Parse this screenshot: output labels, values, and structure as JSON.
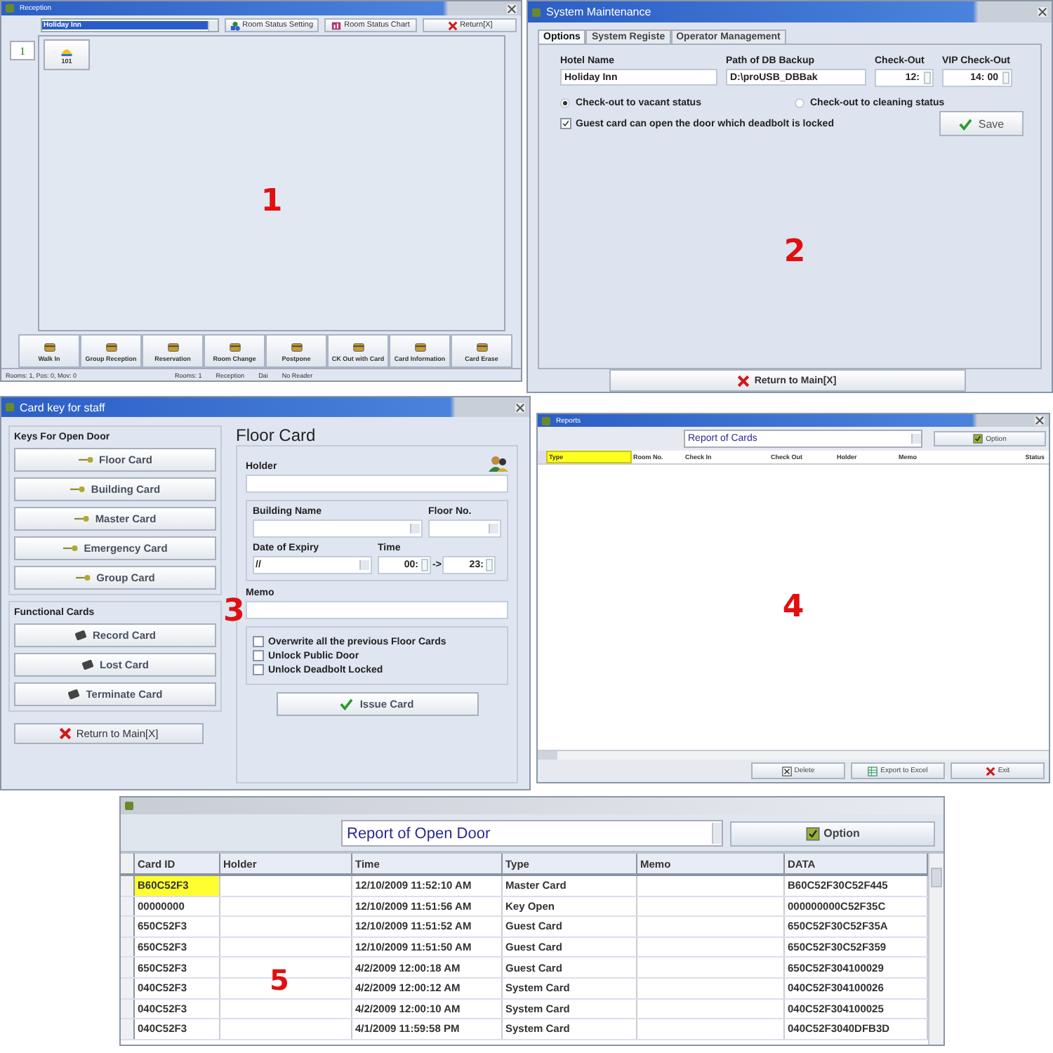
{
  "reception": {
    "title": "Reception",
    "hotel_select": "Holiday Inn",
    "toolbar_buttons": [
      {
        "label": "Room Status Setting",
        "kind": "setting"
      },
      {
        "label": "Room Status Chart",
        "kind": "chart"
      },
      {
        "label": "Return[X]",
        "kind": "return"
      }
    ],
    "floors": [
      "1"
    ],
    "rooms": [
      "101"
    ],
    "panel_number": "1",
    "actions": [
      "Walk In",
      "Group Reception",
      "Reservation",
      "Room Change",
      "Postpone",
      "CK Out with Card",
      "Card Information",
      "Card Erase"
    ],
    "status_bar": [
      "Rooms: 1, Pos: 0, Mov: 0",
      "Rooms: 1",
      "Reception",
      "Dai",
      "No Reader"
    ]
  },
  "maintenance": {
    "title": "System Maintenance",
    "tabs": [
      {
        "label": "Options",
        "selected": true
      },
      {
        "label": "System Registe",
        "selected": false
      },
      {
        "label": "Operator Management",
        "selected": false
      }
    ],
    "fields": [
      {
        "label": "Hotel Name",
        "value": "Holiday Inn",
        "kind": "text"
      },
      {
        "label": "Path of DB Backup",
        "value": "D:\\proUSB_DBBak",
        "kind": "text"
      },
      {
        "label": "Check-Out",
        "value": "12:",
        "kind": "time"
      },
      {
        "label": "VIP Check-Out",
        "value": "14: 00",
        "kind": "time"
      }
    ],
    "radios": [
      {
        "label": "Check-out to vacant status",
        "selected": true
      },
      {
        "label": "Check-out to cleaning status",
        "selected": false
      }
    ],
    "checkbox": {
      "label": "Guest card can open the door which deadbolt is locked",
      "checked": true
    },
    "save_button": "Save",
    "return_button": "Return to Main[X]",
    "panel_number": "2"
  },
  "card_key": {
    "title": "Card key for staff",
    "keys_group": {
      "title": "Keys For Open Door",
      "buttons": [
        "Floor Card",
        "Building Card",
        "Master Card",
        "Emergency Card",
        "Group Card"
      ]
    },
    "functional_group": {
      "title": "Functional Cards",
      "buttons": [
        "Record Card",
        "Lost Card",
        "Terminate Card"
      ]
    },
    "return_button": "Return to Main[X]",
    "form": {
      "title": "Floor Card",
      "holder_label": "Holder",
      "building_label": "Building Name",
      "floor_label": "Floor No.",
      "expiry_label": "Date of Expiry",
      "expiry_value": "//",
      "time_label": "Time",
      "time_from": "00:",
      "time_arrow": "->",
      "time_to": "23:",
      "memo_label": "Memo",
      "options": [
        {
          "label": "Overwrite all the previous Floor Cards",
          "checked": false
        },
        {
          "label": "Unlock Public Door",
          "checked": false
        },
        {
          "label": "Unlock Deadbolt Locked",
          "checked": false
        }
      ],
      "issue_button": "Issue Card"
    },
    "panel_number": "3"
  },
  "reports": {
    "title": "Reports",
    "report_select": "Report of Cards",
    "option_button": "Option",
    "columns": [
      {
        "label": "Type",
        "selected": true
      },
      {
        "label": "Room No.",
        "selected": false
      },
      {
        "label": "Check In",
        "selected": false
      },
      {
        "label": "Check Out",
        "selected": false
      },
      {
        "label": "Holder",
        "selected": false
      },
      {
        "label": "Memo",
        "selected": false
      },
      {
        "label": "Status",
        "selected": false
      }
    ],
    "buttons": [
      {
        "label": "Delete",
        "kind": "delete"
      },
      {
        "label": "Export to Excel",
        "kind": "export"
      },
      {
        "label": "Exit",
        "kind": "exit"
      }
    ],
    "panel_number": "4"
  },
  "open_door_report": {
    "report_select": "Report of Open Door",
    "option_button": "Option",
    "columns": [
      "Card ID",
      "Holder",
      "Time",
      "Type",
      "Memo",
      "DATA"
    ],
    "rows": [
      {
        "cells": [
          "B60C52F3",
          "",
          "12/10/2009 11:52:10 AM",
          "Master Card",
          "",
          "B60C52F30C52F445"
        ],
        "selected": true
      },
      {
        "cells": [
          "00000000",
          "",
          "12/10/2009 11:51:56 AM",
          "Key Open",
          "",
          "000000000C52F35C"
        ],
        "selected": false
      },
      {
        "cells": [
          "650C52F3",
          "",
          "12/10/2009 11:51:52 AM",
          "Guest Card",
          "",
          "650C52F30C52F35A"
        ],
        "selected": false
      },
      {
        "cells": [
          "650C52F3",
          "",
          "12/10/2009 11:51:50 AM",
          "Guest Card",
          "",
          "650C52F30C52F359"
        ],
        "selected": false
      },
      {
        "cells": [
          "650C52F3",
          "",
          "4/2/2009 12:00:18 AM",
          "Guest Card",
          "",
          "650C52F304100029"
        ],
        "selected": false
      },
      {
        "cells": [
          "040C52F3",
          "",
          "4/2/2009 12:00:12 AM",
          "System Card",
          "",
          "040C52F304100026"
        ],
        "selected": false
      },
      {
        "cells": [
          "040C52F3",
          "",
          "4/2/2009 12:00:10 AM",
          "System Card",
          "",
          "040C52F304100025"
        ],
        "selected": false
      },
      {
        "cells": [
          "040C52F3",
          "",
          "4/1/2009 11:59:58 PM",
          "System Card",
          "",
          "040C52F3040DFB3D"
        ],
        "selected": false
      }
    ],
    "panel_number": "5"
  }
}
